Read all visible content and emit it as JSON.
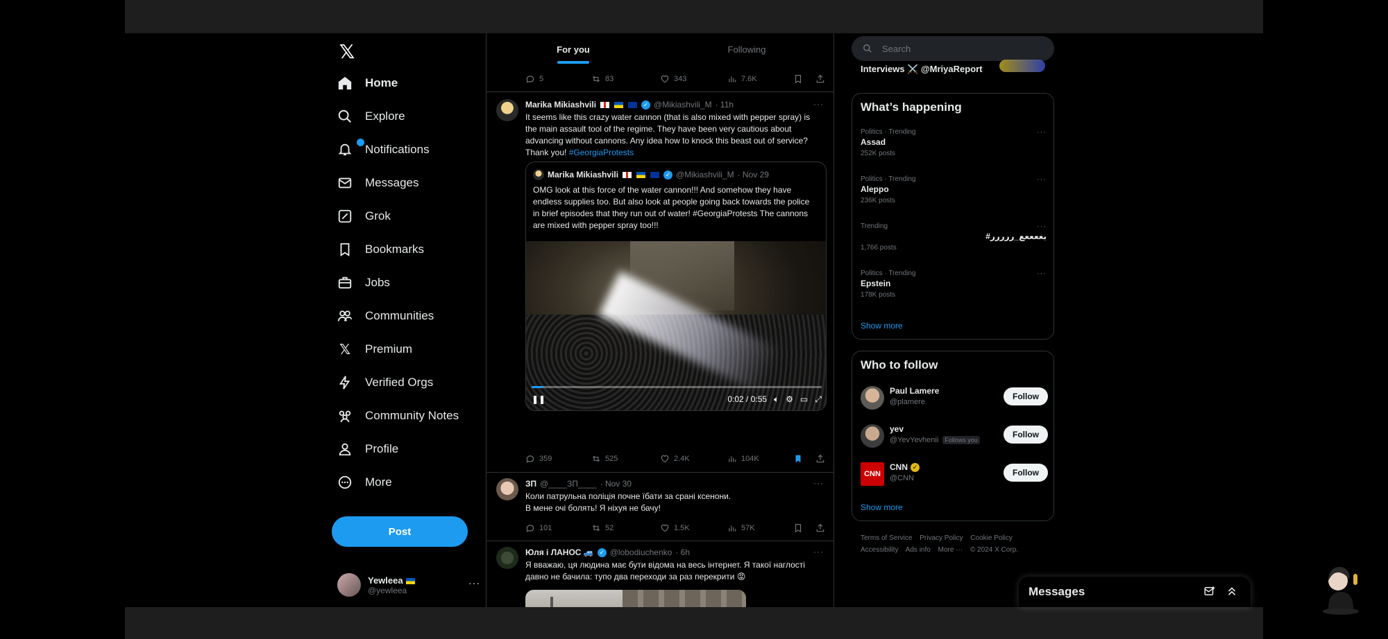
{
  "nav": {
    "items": [
      {
        "label": "Home",
        "icon": "home-icon"
      },
      {
        "label": "Explore",
        "icon": "search-icon"
      },
      {
        "label": "Notifications",
        "icon": "bell-icon"
      },
      {
        "label": "Messages",
        "icon": "mail-icon"
      },
      {
        "label": "Grok",
        "icon": "grok-icon"
      },
      {
        "label": "Bookmarks",
        "icon": "bookmark-icon"
      },
      {
        "label": "Jobs",
        "icon": "briefcase-icon"
      },
      {
        "label": "Communities",
        "icon": "people-icon"
      },
      {
        "label": "Premium",
        "icon": "x-logo-icon"
      },
      {
        "label": "Verified Orgs",
        "icon": "lightning-icon"
      },
      {
        "label": "Community Notes",
        "icon": "community-notes-icon"
      },
      {
        "label": "Profile",
        "icon": "person-icon"
      },
      {
        "label": "More",
        "icon": "more-circle-icon"
      }
    ],
    "post_label": "Post",
    "account": {
      "name": "Yewleea",
      "handle": "@yewleea"
    }
  },
  "feed": {
    "tabs": [
      "For you",
      "Following"
    ],
    "prev_actions": {
      "replies": "5",
      "reposts": "83",
      "likes": "343",
      "views": "7.6K"
    },
    "tweets": [
      {
        "name": "Marika Mikiashvili",
        "handle": "@Mikiashvili_M",
        "time": "· 11h",
        "text": "It seems like this crazy water cannon (that is also mixed with pepper spray) is the main assault tool of the regime. They have been very cautious about advancing without cannons. Any idea how to knock this beast out of service? Thank you!",
        "hashtag": "#GeorgiaProtests",
        "quote": {
          "name": "Marika Mikiashvili",
          "handle": "@Mikiashvili_M",
          "time": "· Nov 29",
          "text": "OMG look at this force of the water cannon!!! And somehow they have endless supplies too. But also look at people going back towards the police in brief episodes that they run out of water! #GeorgiaProtests The cannons are mixed with pepper spray too!!!",
          "video_time": "0:02 / 0:55",
          "video_progress": 0.04
        },
        "actions": {
          "replies": "359",
          "reposts": "525",
          "likes": "2.4K",
          "views": "104K"
        }
      },
      {
        "name": "ЗП",
        "handle": "@____ЗП____",
        "time": "· Nov 30",
        "text_line1": "Коли патрульна поліція почне їбати за сранi ксенони.",
        "text_line2": "В мене очі болять! Я ніхуя не бачу!",
        "actions": {
          "replies": "101",
          "reposts": "52",
          "likes": "1.5K",
          "views": "57K"
        }
      },
      {
        "name": "Юля і ЛАНОС 🚙",
        "handle": "@lobodiuchenko",
        "time": "· 6h",
        "text": "Я вважаю, ця людина має бути відома на весь інтернет. Я такої наглості давно не бачила: тупо два переходи за раз перекрити 😡"
      }
    ]
  },
  "right": {
    "search_placeholder": "Search",
    "prev_card_line": "Interviews ⚔️ @MriyaReport",
    "happening": {
      "title": "What’s happening",
      "trends": [
        {
          "context": "Politics · Trending",
          "topic": "Assad",
          "posts": "252K posts"
        },
        {
          "context": "Politics · Trending",
          "topic": "Aleppo",
          "posts": "236K posts"
        },
        {
          "context": "Trending",
          "topic": "#بععععع_ررررر",
          "posts": "1,766 posts"
        },
        {
          "context": "Politics · Trending",
          "topic": "Epstein",
          "posts": "178K posts"
        }
      ],
      "show_more": "Show more"
    },
    "who_to_follow": {
      "title": "Who to follow",
      "accounts": [
        {
          "name": "Paul Lamere",
          "handle": "@plamere",
          "follows_you": "",
          "button": "Follow"
        },
        {
          "name": "yev",
          "handle": "@YevYevhenii",
          "follows_you": "Follows you",
          "button": "Follow"
        },
        {
          "name": "CNN",
          "handle": "@CNN",
          "follows_you": "",
          "button": "Follow"
        }
      ],
      "show_more": "Show more"
    },
    "footer": {
      "links": [
        "Terms of Service",
        "Privacy Policy",
        "Cookie Policy",
        "Accessibility",
        "Ads info",
        "More ···",
        "© 2024 X Corp."
      ]
    }
  },
  "messages_bar": {
    "title": "Messages"
  },
  "colors": {
    "accent": "#1d9bf0",
    "background": "#000000",
    "border": "#2f3336",
    "muted": "#71767b"
  }
}
